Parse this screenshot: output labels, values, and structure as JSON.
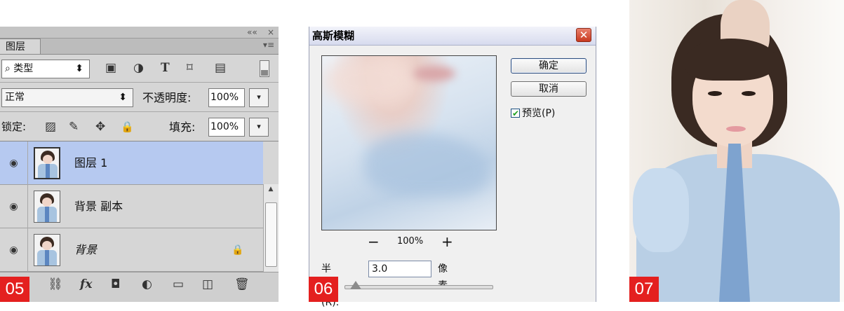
{
  "badges": {
    "p1": "05",
    "p2": "06",
    "p3": "07"
  },
  "layers": {
    "window_controls": {
      "collapse": "««",
      "close": "×"
    },
    "tab_label": "图层",
    "panel_menu": "▾≡",
    "filter": {
      "icon": "⌕",
      "label": "类型",
      "arrows": "⬍"
    },
    "filter_tools": [
      "▣",
      "◑",
      "T",
      "⌑",
      "▤"
    ],
    "blend_mode": "正常",
    "blend_arrows": "⬍",
    "opacity_label": "不透明度:",
    "opacity_value": "100%",
    "lock_label": "锁定:",
    "lock_tools": [
      "▨",
      "✎",
      "✥",
      "🔒"
    ],
    "fill_label": "填充:",
    "fill_value": "100%",
    "dropdown_glyph": "▾",
    "eye_glyph": "◉",
    "lock_glyph": "🔒",
    "items": [
      {
        "name": "图层 1",
        "selected": true
      },
      {
        "name": "背景 副本",
        "selected": false
      },
      {
        "name": "背景",
        "selected": false
      }
    ],
    "bottom_icons": [
      "⛓",
      "fx",
      "◘",
      "◐",
      "▭",
      "◫",
      "🗑"
    ]
  },
  "gauss": {
    "title": "高斯模糊",
    "close_glyph": "✕",
    "ok": "确定",
    "cancel": "取消",
    "preview_check": "✔",
    "preview_label": "预览(P)",
    "zoom_minus": "−",
    "zoom_value": "100%",
    "zoom_plus": "+",
    "radius_label": "半径(R):",
    "radius_value": "3.0",
    "radius_unit": "像素"
  },
  "colors": {
    "badge": "#e4201f",
    "selected_layer": "#b6c9f0"
  }
}
